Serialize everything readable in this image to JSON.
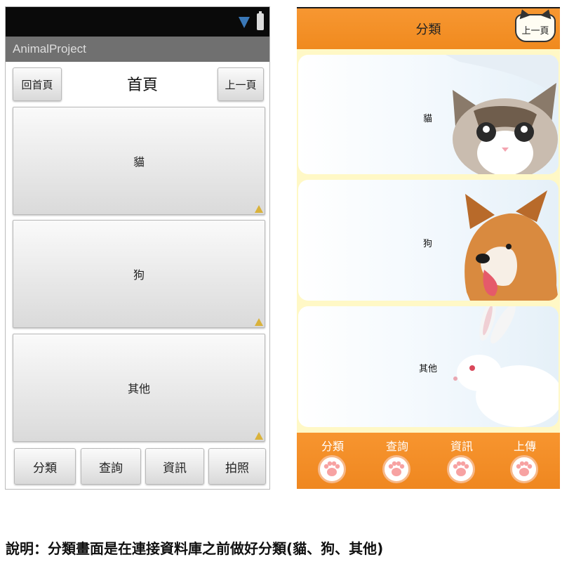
{
  "left_screen": {
    "app_name": "AnimalProject",
    "heading": "首頁",
    "home_button": "回首頁",
    "back_button": "上一頁",
    "categories": [
      "貓",
      "狗",
      "其他"
    ],
    "bottom_nav": [
      "分類",
      "查詢",
      "資訊",
      "拍照"
    ]
  },
  "right_screen": {
    "title": "分類",
    "back_button": "上一頁",
    "cards": [
      "貓",
      "狗",
      "其他"
    ],
    "tabs": [
      "分類",
      "查詢",
      "資訊",
      "上傳"
    ],
    "colors": {
      "header": "#f08a1e",
      "background": "#fff8c6",
      "paw": "#f7b98a"
    }
  },
  "caption": "說明：分類畫面是在連接資料庫之前做好分類(貓、狗、其他)"
}
